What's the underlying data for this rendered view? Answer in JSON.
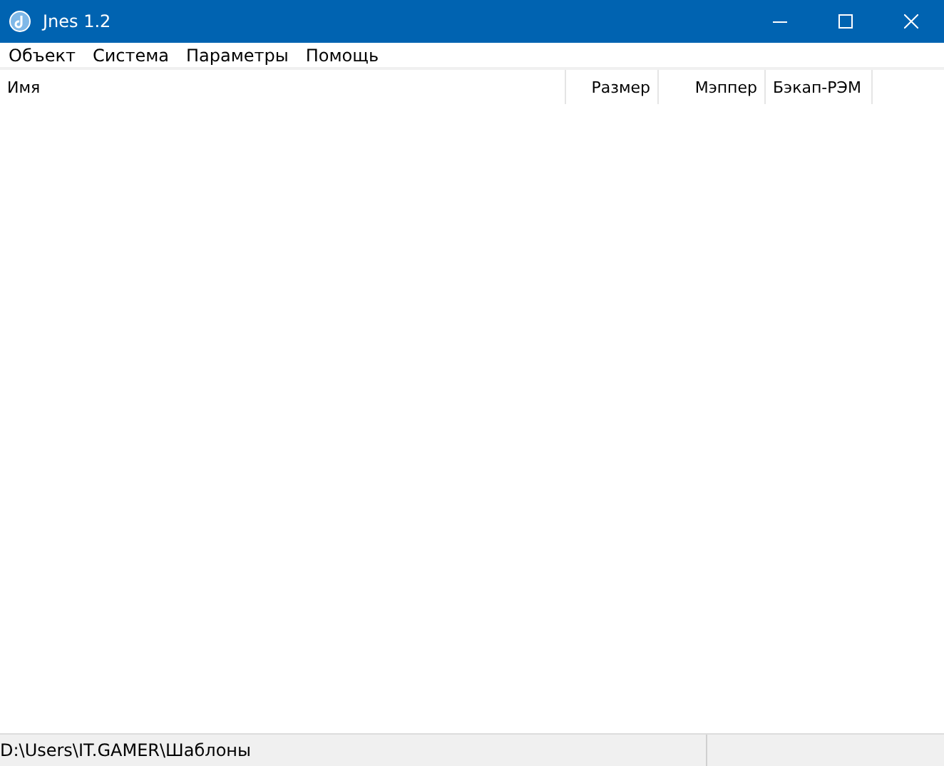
{
  "window": {
    "title": "Jnes 1.2"
  },
  "menu": [
    "Объект",
    "Система",
    "Параметры",
    "Помощь"
  ],
  "table": {
    "columns": [
      "Имя",
      "Размер",
      "Мэппер",
      "Бэкап-РЭМ"
    ]
  },
  "status_bar": {
    "path": "D:\\Users\\IT.GAMER\\Шаблоны"
  }
}
